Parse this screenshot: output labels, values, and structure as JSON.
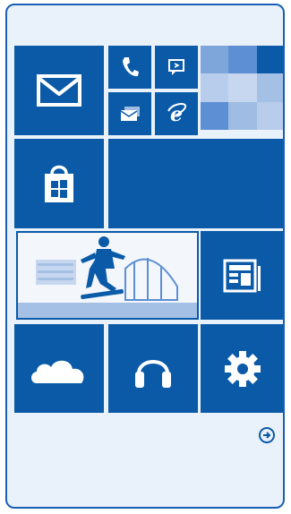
{
  "theme": {
    "tile_blue": "#0a5aa8",
    "background": "#e9f1fa",
    "border": "#1a5fb4",
    "mosaic_colors": [
      "#5c8fd3",
      "#3a6fbe",
      "#0a5aa8",
      "#9fbce3",
      "#c7d7ef",
      "#a5c0e5",
      "#7fa6da",
      "#5c8fd3",
      "#b8cdeb"
    ]
  },
  "tiles": [
    {
      "name": "mail-tile",
      "icon": "mail-icon"
    },
    {
      "name": "phone-tile",
      "icon": "phone-icon"
    },
    {
      "name": "messaging-tile",
      "icon": "messaging-icon"
    },
    {
      "name": "people-mosaic-tile",
      "icon": "mosaic"
    },
    {
      "name": "outlook-tile",
      "icon": "envelope-stack-icon"
    },
    {
      "name": "internet-explorer-tile",
      "icon": "ie-icon"
    },
    {
      "name": "store-tile",
      "icon": "store-bag-icon"
    },
    {
      "name": "wide-blank-tile",
      "icon": ""
    },
    {
      "name": "photos-tile",
      "icon": "skateboarder-photo"
    },
    {
      "name": "news-tile",
      "icon": "news-icon"
    },
    {
      "name": "onedrive-tile",
      "icon": "cloud-icon"
    },
    {
      "name": "music-tile",
      "icon": "headphones-icon"
    },
    {
      "name": "settings-tile",
      "icon": "gear-icon"
    }
  ],
  "more_arrow": {
    "icon": "arrow-right-circle-icon"
  }
}
